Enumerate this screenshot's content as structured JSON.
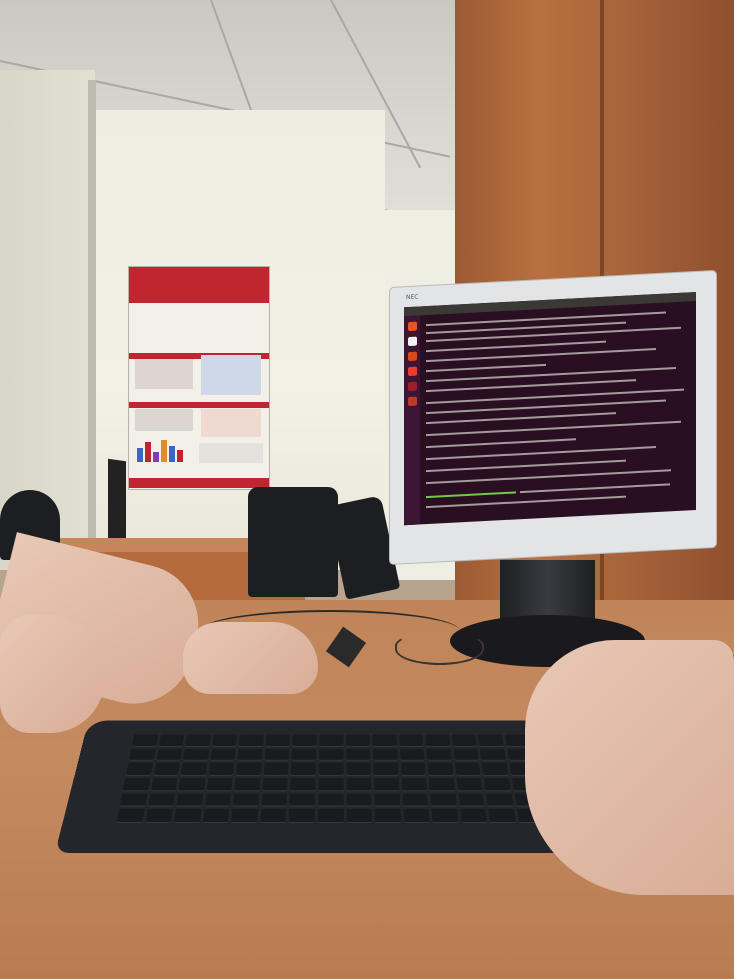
{
  "scene": {
    "description_tags": [
      "office",
      "desk",
      "keyboard",
      "monitor",
      "terminal",
      "poster",
      "hands"
    ],
    "monitor": {
      "brand_label": "NEC",
      "screen": {
        "os_theme": "ubuntu",
        "content": "terminal",
        "launcher_icon_colors": [
          "#e95420",
          "#f2f2f2",
          "#d94a1a",
          "#ef3b2d",
          "#9e1f2b",
          "#c0392b"
        ]
      }
    },
    "colors": {
      "desk": "#c08458",
      "cabinet": "#a8643a",
      "terminal_bg": "#2a0f22",
      "poster_accent": "#c0262f",
      "keyboard": "#25262b"
    }
  }
}
